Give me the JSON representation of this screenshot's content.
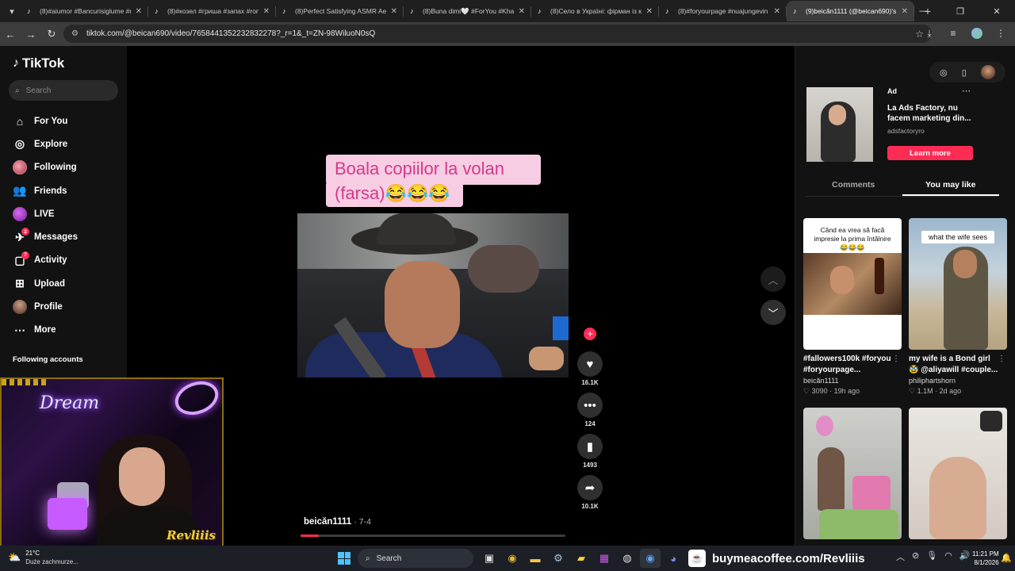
{
  "browser": {
    "tabs": [
      {
        "title": "(8)#aiumor #Bancurisiglume #r",
        "active": false
      },
      {
        "title": "(8)#козел #гриша #запах #rom",
        "active": false
      },
      {
        "title": "(8)Perfect Satisfying ASMR Aes",
        "active": false
      },
      {
        "title": "(8)Buna dimi🤍 #ForYou #Khal",
        "active": false
      },
      {
        "title": "(8)Село в Україні: фірман із ко",
        "active": false
      },
      {
        "title": "(8)#foryourpage #nuajungevin",
        "active": false
      },
      {
        "title": "(9)beicăn1111 (@beican690)'s",
        "active": true
      }
    ],
    "url": "tiktok.com/@beican690/video/7658441352232832278?_r=1&_t=ZN-98WiluoN0sQ"
  },
  "sidebar": {
    "logo": "TikTok",
    "search_placeholder": "Search",
    "nav": [
      {
        "label": "For You",
        "icon": "home-icon"
      },
      {
        "label": "Explore",
        "icon": "compass-icon"
      },
      {
        "label": "Following",
        "icon": "following-avatar-icon"
      },
      {
        "label": "Friends",
        "icon": "friends-icon"
      },
      {
        "label": "LIVE",
        "icon": "live-icon"
      },
      {
        "label": "Messages",
        "icon": "messages-icon",
        "badge": "2"
      },
      {
        "label": "Activity",
        "icon": "activity-icon",
        "badge": "7"
      },
      {
        "label": "Upload",
        "icon": "upload-icon"
      },
      {
        "label": "Profile",
        "icon": "profile-icon"
      },
      {
        "label": "More",
        "icon": "more-icon"
      }
    ],
    "following_accounts": "Following accounts"
  },
  "webcam": {
    "neon_sign": "Dream",
    "streamer_name": "Revliiis"
  },
  "video": {
    "caption_line1": "Boala copiilor la volan",
    "caption_line2": "(farsa)😂😂😂",
    "author": "beicăn1111",
    "date": "7-4",
    "progress": 0.07
  },
  "actions": {
    "likes": "16.1K",
    "comments": "124",
    "saves": "1493",
    "shares": "10.1K"
  },
  "right_panel": {
    "ad": {
      "label": "Ad",
      "title": "La Ads Factory, nu facem marketing din...",
      "domain": "adsfactoryro",
      "button": "Learn more"
    },
    "tabs": [
      {
        "label": "Comments",
        "active": false
      },
      {
        "label": "You may like",
        "active": true
      }
    ],
    "cards": [
      {
        "thumb_text": "Când ea vrea să facă impresie la prima întâlnire😂😂😂",
        "title": "#fallowers100k #foryou #foryourpage...",
        "author": "beicăn1111",
        "likes": "3090",
        "age": "19h ago"
      },
      {
        "thumb_text": "what the wife sees",
        "title": "my wife is a Bond girl 🥸 @aliyawill #couple...",
        "author": "philiphartshorn",
        "likes": "1.1M",
        "age": "2d ago"
      },
      {
        "thumb_text": "",
        "title": "",
        "author": "",
        "likes": "",
        "age": ""
      },
      {
        "thumb_text": "",
        "title": "",
        "author": "",
        "likes": "",
        "age": ""
      }
    ]
  },
  "taskbar": {
    "temperature": "21°C",
    "weather_desc": "Duże zachmurze...",
    "search": "Search",
    "promo_url": "buymeacoffee.com/Revliiis",
    "time": "11:21 PM",
    "date": "8/1/2026"
  }
}
